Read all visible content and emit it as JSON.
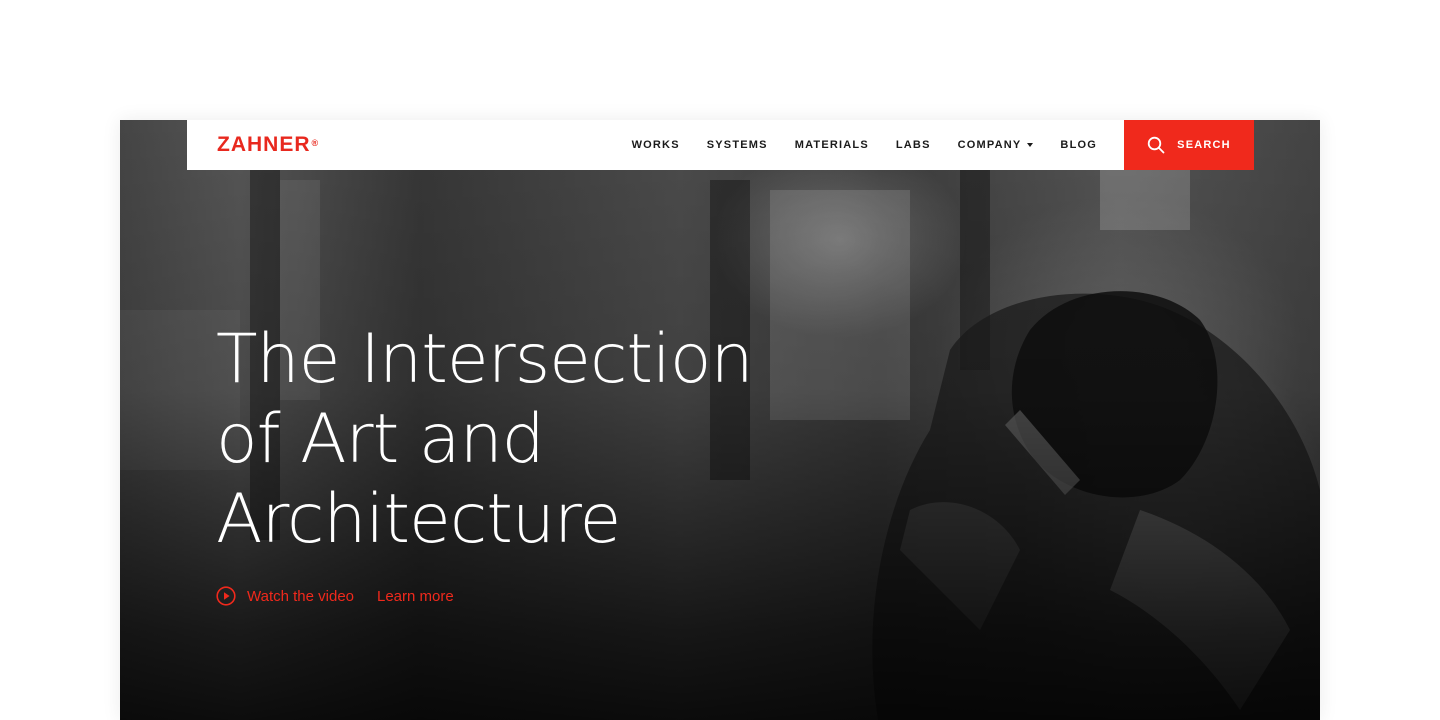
{
  "brand": {
    "logo_text": "ZAHNER",
    "logo_mark": "®",
    "accent_color": "#f0291c"
  },
  "nav": {
    "items": [
      {
        "label": "WORKS"
      },
      {
        "label": "SYSTEMS"
      },
      {
        "label": "MATERIALS"
      },
      {
        "label": "LABS"
      },
      {
        "label": "COMPANY",
        "has_dropdown": true
      },
      {
        "label": "BLOG"
      }
    ],
    "search_label": "SEARCH",
    "search_icon": "search-icon"
  },
  "hero": {
    "title_lines": [
      "The Intersection",
      "of Art and",
      "Architecture"
    ],
    "watch_label": "Watch the video",
    "watch_icon": "play-circle-icon",
    "learn_label": "Learn more"
  }
}
